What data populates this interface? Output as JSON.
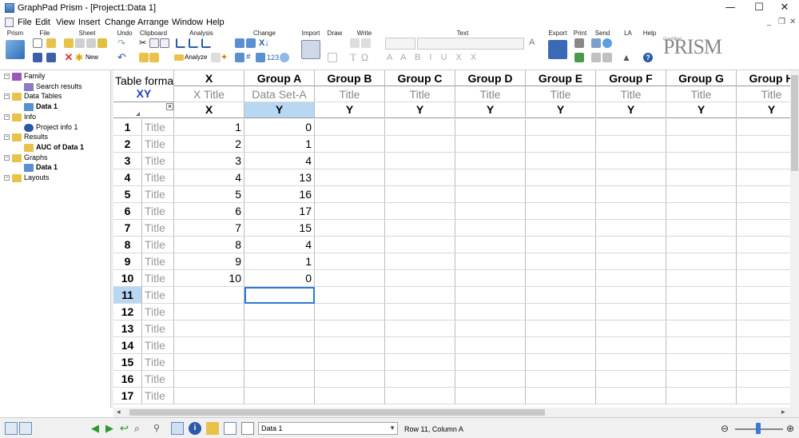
{
  "window": {
    "title": "GraphPad Prism - [Project1:Data 1]",
    "controls": {
      "minimize": "—",
      "maximize": "☐",
      "close": "✕"
    }
  },
  "menu": {
    "items": [
      "File",
      "Edit",
      "View",
      "Insert",
      "Change",
      "Arrange",
      "Window",
      "Help"
    ],
    "mdi_controls": [
      "_",
      "❐",
      "✕"
    ]
  },
  "ribbon": {
    "groups": [
      {
        "label": "Prism"
      },
      {
        "label": "File"
      },
      {
        "label": "Sheet"
      },
      {
        "label": "Undo"
      },
      {
        "label": "Clipboard"
      },
      {
        "label": "Analysis"
      },
      {
        "label": "Change"
      },
      {
        "label": "Import"
      },
      {
        "label": "Draw"
      },
      {
        "label": "Write"
      },
      {
        "label": "Text"
      },
      {
        "label": "Export"
      },
      {
        "label": "Print"
      },
      {
        "label": "Send"
      },
      {
        "label": "LA"
      },
      {
        "label": "Help"
      }
    ],
    "new_label": "New",
    "analyze_label": "Analyze",
    "logo_small": "GraphPad",
    "logo": "PRISM"
  },
  "navigator": {
    "items": [
      {
        "label": "Family",
        "level": 0,
        "bold": false,
        "icon": "family-icon"
      },
      {
        "label": "Search results",
        "level": 1,
        "bold": false,
        "icon": "search-results-icon"
      },
      {
        "label": "Data Tables",
        "level": 0,
        "bold": false,
        "icon": "folder-icon"
      },
      {
        "label": "Data 1",
        "level": 1,
        "bold": true,
        "icon": "data-table-icon"
      },
      {
        "label": "Info",
        "level": 0,
        "bold": false,
        "icon": "folder-icon"
      },
      {
        "label": "Project info 1",
        "level": 1,
        "bold": false,
        "icon": "info-icon"
      },
      {
        "label": "Results",
        "level": 0,
        "bold": false,
        "icon": "folder-icon"
      },
      {
        "label": "AUC of Data 1",
        "level": 1,
        "bold": true,
        "icon": "results-icon"
      },
      {
        "label": "Graphs",
        "level": 0,
        "bold": false,
        "icon": "folder-icon"
      },
      {
        "label": "Data 1",
        "level": 1,
        "bold": true,
        "icon": "graph-icon"
      },
      {
        "label": "Layouts",
        "level": 0,
        "bold": false,
        "icon": "folder-icon"
      }
    ]
  },
  "sheet": {
    "format_label": "Table format:",
    "format_value": "XY",
    "close_glyph": "×",
    "columns": [
      {
        "name": "X",
        "title": "X Title",
        "sub": "X"
      },
      {
        "name": "Group A",
        "title": "Data Set-A",
        "sub": "Y"
      },
      {
        "name": "Group B",
        "title": "Title",
        "sub": "Y"
      },
      {
        "name": "Group C",
        "title": "Title",
        "sub": "Y"
      },
      {
        "name": "Group D",
        "title": "Title",
        "sub": "Y"
      },
      {
        "name": "Group E",
        "title": "Title",
        "sub": "Y"
      },
      {
        "name": "Group F",
        "title": "Title",
        "sub": "Y"
      },
      {
        "name": "Group G",
        "title": "Title",
        "sub": "Y"
      },
      {
        "name": "Group H",
        "title": "Title",
        "sub": "Y"
      }
    ],
    "row_title_placeholder": "Title",
    "rows": [
      {
        "n": "1",
        "x": "1",
        "a": "0"
      },
      {
        "n": "2",
        "x": "2",
        "a": "1"
      },
      {
        "n": "3",
        "x": "3",
        "a": "4"
      },
      {
        "n": "4",
        "x": "4",
        "a": "13"
      },
      {
        "n": "5",
        "x": "5",
        "a": "16"
      },
      {
        "n": "6",
        "x": "6",
        "a": "17"
      },
      {
        "n": "7",
        "x": "7",
        "a": "15"
      },
      {
        "n": "8",
        "x": "8",
        "a": "4"
      },
      {
        "n": "9",
        "x": "9",
        "a": "1"
      },
      {
        "n": "10",
        "x": "10",
        "a": "0"
      },
      {
        "n": "11",
        "x": "",
        "a": ""
      },
      {
        "n": "12",
        "x": "",
        "a": ""
      },
      {
        "n": "13",
        "x": "",
        "a": ""
      },
      {
        "n": "14",
        "x": "",
        "a": ""
      },
      {
        "n": "15",
        "x": "",
        "a": ""
      },
      {
        "n": "16",
        "x": "",
        "a": ""
      },
      {
        "n": "17",
        "x": "",
        "a": ""
      }
    ],
    "selected_row": "11",
    "selected_column": "Group A",
    "highlight_color": "#b8d7f3"
  },
  "status": {
    "sheet_name": "Data 1",
    "cell_ref": "Row 11, Column A"
  }
}
